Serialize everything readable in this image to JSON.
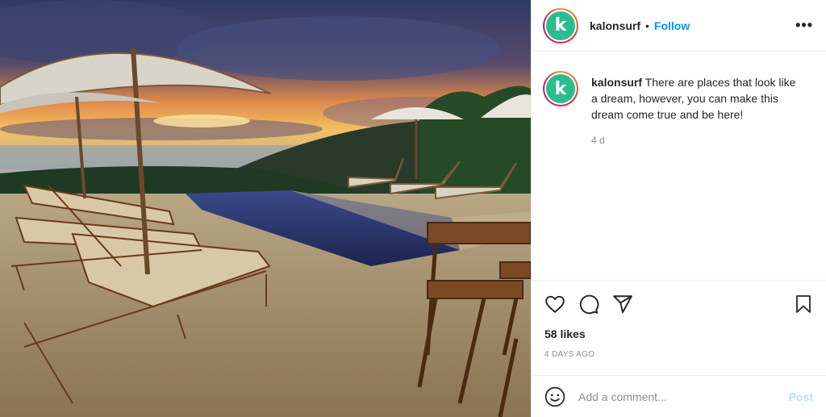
{
  "post": {
    "username": "kalonsurf",
    "follow_label": "Follow",
    "separator": "•",
    "avatar_letter": "k",
    "more_label": "•••",
    "caption_text": "There are places that look like a dream, however, you can make this dream come true and be here!",
    "caption_time": "4 d",
    "likes": "58 likes",
    "date": "4 DAYS AGO"
  },
  "comment": {
    "placeholder": "Add a comment...",
    "post_label": "Post"
  },
  "colors": {
    "accent": "#0095f6",
    "post_disabled": "#b2dffc",
    "avatar_bg": "#2bbd8f"
  },
  "icons": [
    "heart-icon",
    "comment-icon",
    "share-icon",
    "bookmark-icon",
    "emoji-icon",
    "more-icon"
  ]
}
